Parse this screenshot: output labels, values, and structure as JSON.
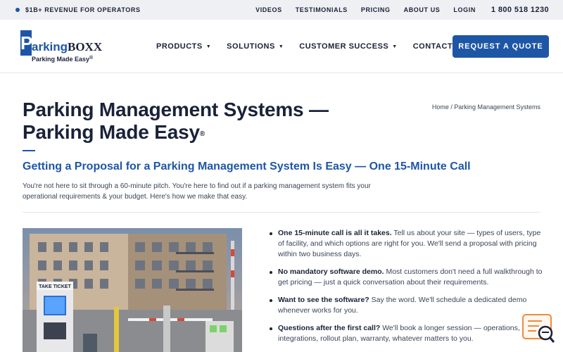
{
  "topbar": {
    "revenue": "$1B+ REVENUE FOR OPERATORS",
    "links": [
      "VIDEOS",
      "TESTIMONIALS",
      "PRICING",
      "ABOUT US",
      "LOGIN"
    ],
    "phone": "1 800 518 1230"
  },
  "logo": {
    "p": "P",
    "arking": "arking",
    "boxx": "BOXX",
    "tagline": "Parking Made Easy",
    "reg": "®"
  },
  "nav": {
    "items": [
      {
        "label": "PRODUCTS",
        "has_caret": true
      },
      {
        "label": "SOLUTIONS",
        "has_caret": true
      },
      {
        "label": "CUSTOMER SUCCESS",
        "has_caret": true
      },
      {
        "label": "CONTACT",
        "has_caret": false
      }
    ],
    "caret": "▼",
    "cta": "REQUEST A QUOTE"
  },
  "page": {
    "title_line1": "Parking Management Systems —",
    "title_line2": "Parking Made Easy",
    "title_reg": "®",
    "breadcrumb": "Home / Parking Management Systems",
    "subhead": "Getting a Proposal for a Parking Management System Is Easy — One 15-Minute Call",
    "intro": "You're not here to sit through a 60-minute pitch. You're here to find out if a parking management system fits your operational requirements & your budget. Here's how we make that easy."
  },
  "photo": {
    "sign_text": "TAKE TICKET"
  },
  "bullets": [
    {
      "bold": "One 15-minute call is all it takes.",
      "text": " Tell us about your site — types of users, type of facility, and which options are right for you. We'll send a proposal with pricing within two business days."
    },
    {
      "bold": "No mandatory software demo.",
      "text": " Most customers don't need a full walkthrough to get pricing — just a quick conversation about their requirements."
    },
    {
      "bold": "Want to see the software?",
      "text": " Say the word. We'll schedule a dedicated demo whenever works for you."
    },
    {
      "bold": "Questions after the first call?",
      "text": " We'll book a longer session — operations, integrations, rollout plan, warranty, whatever matters to you."
    }
  ],
  "colors": {
    "brand_blue": "#1e56a6",
    "navy": "#1a2238",
    "topbar_bg": "#eef0f4",
    "widget_orange": "#f08a3c"
  },
  "icons": {
    "help_widget": "chat-search-icon"
  }
}
